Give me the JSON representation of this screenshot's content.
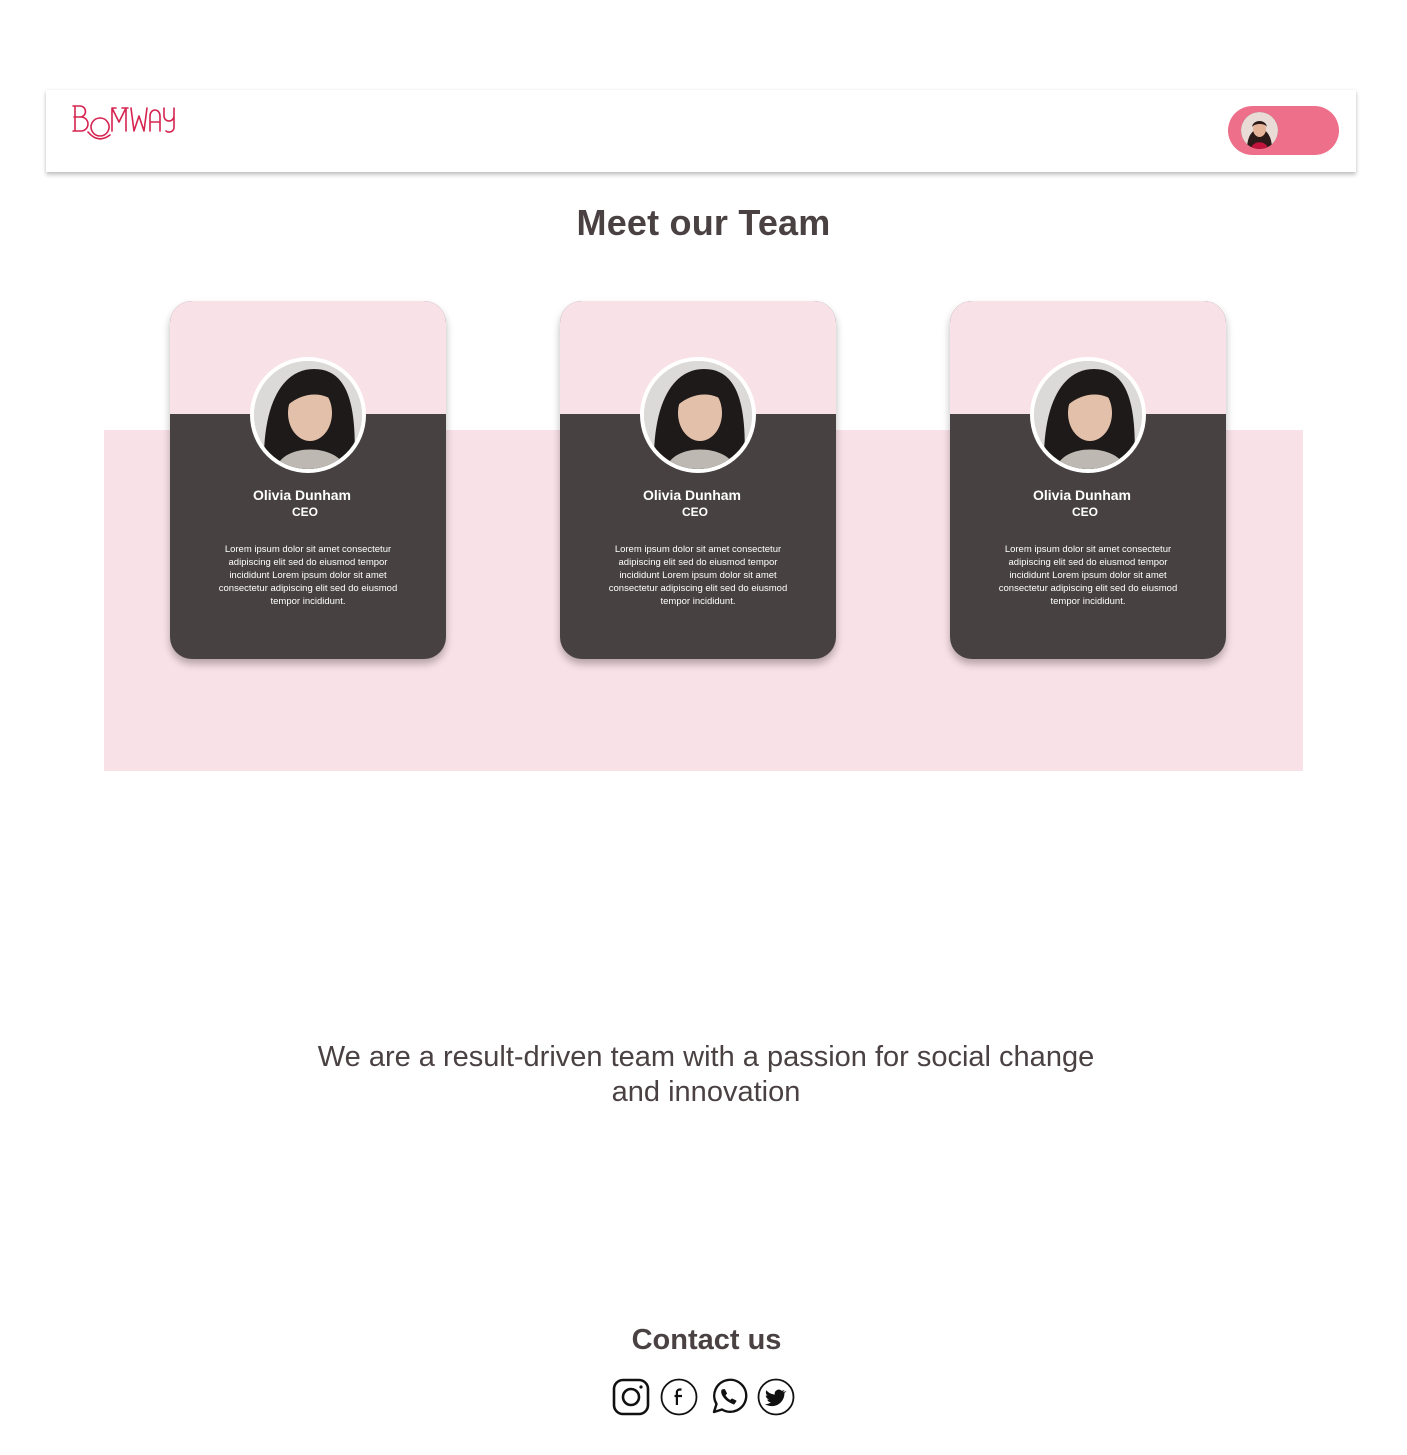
{
  "header": {
    "logo_text": "BOMWAY",
    "brand_color": "#d6234f",
    "pill_color": "#ee6f8a",
    "user_icon": "user-avatar"
  },
  "page_title": "Meet our Team",
  "team": [
    {
      "name": "Olivia Dunham",
      "role": "CEO",
      "bio": "Lorem ipsum dolor sit amet consectetur adipiscing elit sed do eiusmod tempor incididunt Lorem ipsum dolor sit amet consectetur adipiscing elit sed do eiusmod tempor incididunt."
    },
    {
      "name": "Olivia Dunham",
      "role": "CEO",
      "bio": "Lorem ipsum dolor sit amet consectetur adipiscing elit sed do eiusmod tempor incididunt Lorem ipsum dolor sit amet consectetur adipiscing elit sed do eiusmod tempor incididunt."
    },
    {
      "name": "Olivia Dunham",
      "role": "CEO",
      "bio": "Lorem ipsum dolor sit amet consectetur adipiscing elit sed do eiusmod tempor incididunt Lorem ipsum dolor sit amet consectetur adipiscing elit sed do eiusmod tempor incididunt."
    }
  ],
  "tagline": "We are a result-driven team with a passion for social change and innovation",
  "contact": {
    "title": "Contact us",
    "icons": [
      "instagram-icon",
      "facebook-icon",
      "whatsapp-icon",
      "twitter-icon"
    ]
  },
  "colors": {
    "card_dark": "#484142",
    "pink_light": "#f9e1e8",
    "text_dark": "#4a4142"
  }
}
